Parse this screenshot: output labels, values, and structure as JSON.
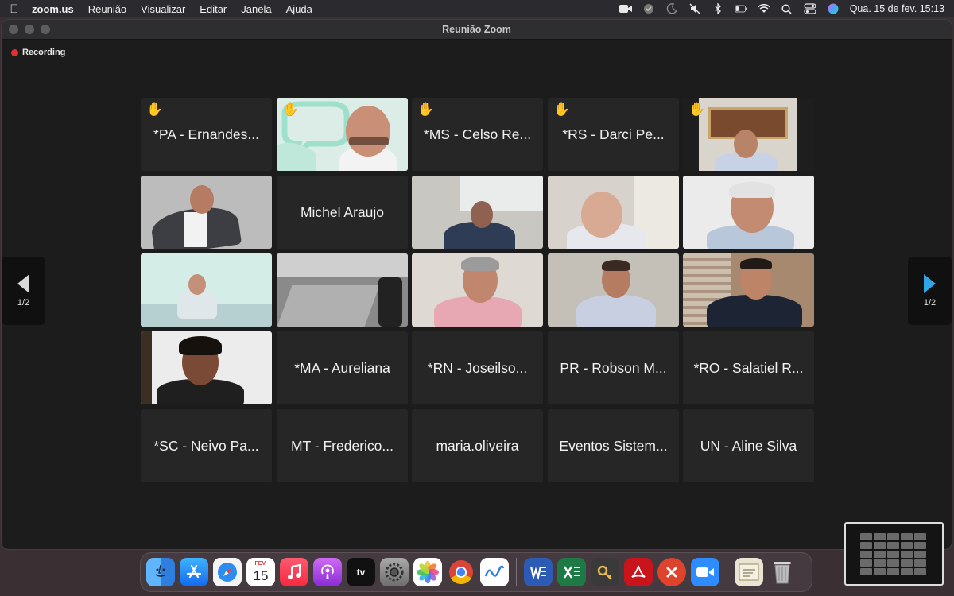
{
  "menubar": {
    "app_name": "zoom.us",
    "items": [
      "Reunião",
      "Visualizar",
      "Editar",
      "Janela",
      "Ajuda"
    ],
    "clock": "Qua. 15 de fev.  15:13"
  },
  "window": {
    "title": "Reunião Zoom",
    "recording_label": "Recording",
    "pager_left": "1/2",
    "pager_right": "1/2"
  },
  "tiles": [
    {
      "id": "t1",
      "label": "*PA - Ernandes...",
      "hand": true
    },
    {
      "id": "t2",
      "label": "",
      "hand": true,
      "active": true
    },
    {
      "id": "t3",
      "label": "*MS - Celso Re...",
      "hand": true
    },
    {
      "id": "t4",
      "label": "*RS - Darci Pe...",
      "hand": true
    },
    {
      "id": "t5",
      "label": "",
      "hand": true
    },
    {
      "id": "t6",
      "label": ""
    },
    {
      "id": "t7",
      "label": "Michel Araujo"
    },
    {
      "id": "t8",
      "label": ""
    },
    {
      "id": "t9",
      "label": ""
    },
    {
      "id": "t10",
      "label": ""
    },
    {
      "id": "t11",
      "label": ""
    },
    {
      "id": "t12",
      "label": ""
    },
    {
      "id": "t13",
      "label": ""
    },
    {
      "id": "t14",
      "label": ""
    },
    {
      "id": "t15",
      "label": ""
    },
    {
      "id": "t16",
      "label": ""
    },
    {
      "id": "t17",
      "label": "*MA - Aureliana"
    },
    {
      "id": "t18",
      "label": "*RN - Joseilso..."
    },
    {
      "id": "t19",
      "label": "PR - Robson M..."
    },
    {
      "id": "t20",
      "label": "*RO - Salatiel R..."
    },
    {
      "id": "t21",
      "label": "*SC - Neivo Pa..."
    },
    {
      "id": "t22",
      "label": "MT - Frederico..."
    },
    {
      "id": "t23",
      "label": "maria.oliveira"
    },
    {
      "id": "t24",
      "label": "Eventos Sistem..."
    },
    {
      "id": "t25",
      "label": "UN - Aline Silva"
    }
  ],
  "dock": {
    "calendar_month": "FEV.",
    "calendar_day": "15",
    "tv_label": "tv"
  },
  "colors": {
    "active_speaker_border": "#33c25a",
    "recording_dot": "#e0322e",
    "pager_arrow_active": "#2fa6e8"
  }
}
